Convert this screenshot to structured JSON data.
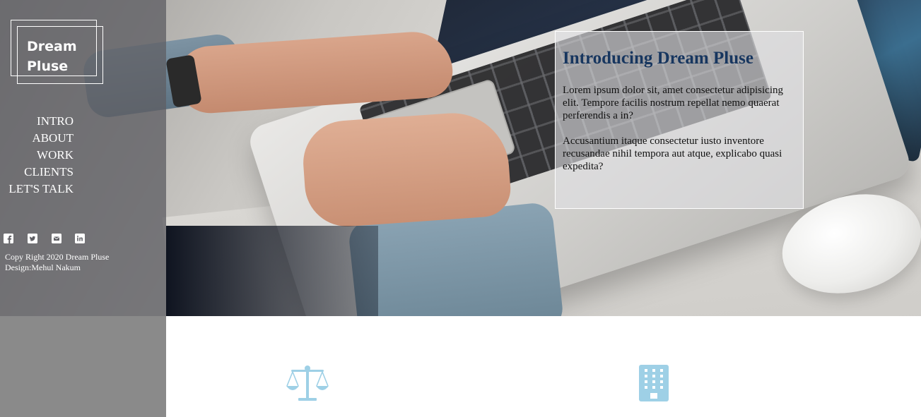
{
  "brand": {
    "line1": "Dream",
    "line2": "Pluse"
  },
  "nav": {
    "items": [
      {
        "label": "INTRO"
      },
      {
        "label": "ABOUT"
      },
      {
        "label": "WORK"
      },
      {
        "label": "CLIENTS"
      },
      {
        "label": "LET'S TALK"
      }
    ]
  },
  "social": {
    "icons": [
      "facebook-icon",
      "twitter-icon",
      "email-icon",
      "linkedin-icon"
    ]
  },
  "footer": {
    "copyright": "Copy Right 2020 Dream Pluse",
    "design": "Design:Mehul Nakum"
  },
  "intro": {
    "title": "Introducing Dream Pluse",
    "paragraph1": "Lorem ipsum dolor sit, amet consectetur adipisicing elit. Tempore facilis nostrum repellat nemo quaerat perferendis a in?",
    "paragraph2": "Accusantium itaque consectetur iusto inventore recusandae nihil tempora aut atque, explicabo quasi expedita?"
  },
  "features": {
    "icons": [
      "balance-scale-icon",
      "building-icon"
    ],
    "icon_color": "#9ed0e6"
  },
  "colors": {
    "sidebar_overlay": "#5f5f64",
    "title": "#17365f"
  }
}
